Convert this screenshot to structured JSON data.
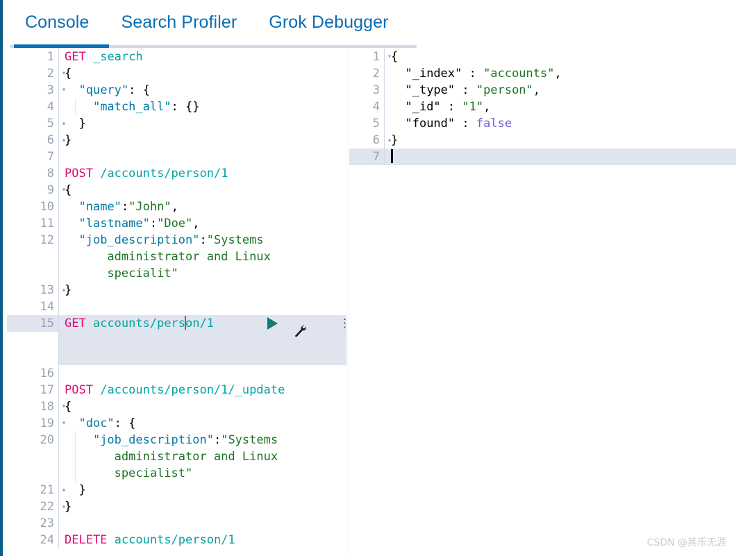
{
  "tabs": [
    {
      "label": "Console",
      "active": true
    },
    {
      "label": "Search Profiler",
      "active": false
    },
    {
      "label": "Grok Debugger",
      "active": false
    }
  ],
  "colors": {
    "accent_blue": "#0b6eb5",
    "tabline_grey": "#d3dae6",
    "method": "#dd0a73",
    "url": "#00a3a3",
    "json_key": "#0079a5",
    "json_string": "#1d7324",
    "json_bool": "#6b5fd6",
    "highlight_row": "#dfe4ee",
    "play_button": "#107b77",
    "left_border": "#0b5d86"
  },
  "request_editor": {
    "name": "Console request editor",
    "lines": [
      {
        "n": "1",
        "fold": "",
        "text": "GET _search"
      },
      {
        "n": "2",
        "fold": "▾",
        "text": "{"
      },
      {
        "n": "3",
        "fold": "▾",
        "text": "  \"query\": {"
      },
      {
        "n": "4",
        "fold": "",
        "text": "    \"match_all\": {}"
      },
      {
        "n": "5",
        "fold": "▴",
        "text": "  }"
      },
      {
        "n": "6",
        "fold": "▴",
        "text": "}"
      },
      {
        "n": "7",
        "fold": "",
        "text": ""
      },
      {
        "n": "8",
        "fold": "",
        "text": "POST /accounts/person/1"
      },
      {
        "n": "9",
        "fold": "▾",
        "text": "{"
      },
      {
        "n": "10",
        "fold": "",
        "text": "  \"name\":\"John\","
      },
      {
        "n": "11",
        "fold": "",
        "text": "  \"lastname\":\"Doe\","
      },
      {
        "n": "12",
        "fold": "",
        "text": "  \"job_description\":\"Systems administrator and Linux specialit\""
      },
      {
        "n": "13",
        "fold": "▴",
        "text": "}"
      },
      {
        "n": "14",
        "fold": "",
        "text": ""
      },
      {
        "n": "15",
        "fold": "",
        "text": "GET accounts/person/1"
      },
      {
        "n": "16",
        "fold": "",
        "text": ""
      },
      {
        "n": "17",
        "fold": "",
        "text": "POST /accounts/person/1/_update"
      },
      {
        "n": "18",
        "fold": "▾",
        "text": "{"
      },
      {
        "n": "19",
        "fold": "▾",
        "text": "  \"doc\": {"
      },
      {
        "n": "20",
        "fold": "",
        "text": "    \"job_description\":\"Systems administrator and Linux specialist\""
      },
      {
        "n": "21",
        "fold": "▴",
        "text": "  }"
      },
      {
        "n": "22",
        "fold": "▴",
        "text": "}"
      },
      {
        "n": "23",
        "fold": "",
        "text": ""
      },
      {
        "n": "24",
        "fold": "",
        "text": "DELETE accounts/person/1"
      }
    ],
    "active_line": {
      "number": "15",
      "method": "GET",
      "path_before_caret": "accounts/pers",
      "path_after_caret": "on/1"
    },
    "tokens": {
      "l1_method": "GET",
      "l1_path": "_search",
      "l3_key": "\"query\"",
      "l4_key": "\"match_all\"",
      "l8_method": "POST",
      "l8_path": "/accounts/person/1",
      "l10_key": "\"name\"",
      "l10_val": "\"John\"",
      "l11_key": "\"lastname\"",
      "l11_val": "\"Doe\"",
      "l12_key": "\"job_description\"",
      "l12_val_a": "\"Systems",
      "l12_val_b": "administrator and Linux",
      "l12_val_c": "specialit\"",
      "l17_method": "POST",
      "l17_path": "/accounts/person/1/_update",
      "l19_key": "\"doc\"",
      "l20_key": "\"job_description\"",
      "l20_val_a": "\"Systems",
      "l20_val_b": "administrator and Linux",
      "l20_val_c": "specialist\"",
      "l24_method": "DELETE",
      "l24_path": "accounts/person/1",
      "brace_open": "{",
      "brace_close": "}",
      "braces_empty": "{}",
      "colon": ":",
      "comma": ","
    },
    "toolbar": {
      "play_label": "▶",
      "wrench_label": "🔧",
      "kebab_label": "⋮"
    }
  },
  "response_editor": {
    "name": "Console response viewer",
    "lines": [
      {
        "n": "1",
        "fold": "▾",
        "text": "{"
      },
      {
        "n": "2",
        "fold": "",
        "text": "  \"_index\" : \"accounts\","
      },
      {
        "n": "3",
        "fold": "",
        "text": "  \"_type\" : \"person\","
      },
      {
        "n": "4",
        "fold": "",
        "text": "  \"_id\" : \"1\","
      },
      {
        "n": "5",
        "fold": "",
        "text": "  \"found\" : false"
      },
      {
        "n": "6",
        "fold": "▴",
        "text": "}"
      },
      {
        "n": "7",
        "fold": "",
        "text": ""
      }
    ],
    "tokens": {
      "k_index": "\"_index\"",
      "v_index": "\"accounts\"",
      "k_type": "\"_type\"",
      "v_type": "\"person\"",
      "k_id": "\"_id\"",
      "v_id": "\"1\"",
      "k_found": "\"found\"",
      "v_found": "false",
      "colon": ":",
      "comma": ",",
      "brace_open": "{",
      "brace_close": "}"
    }
  },
  "watermark": {
    "text": "CSDN @其乐无涯"
  }
}
